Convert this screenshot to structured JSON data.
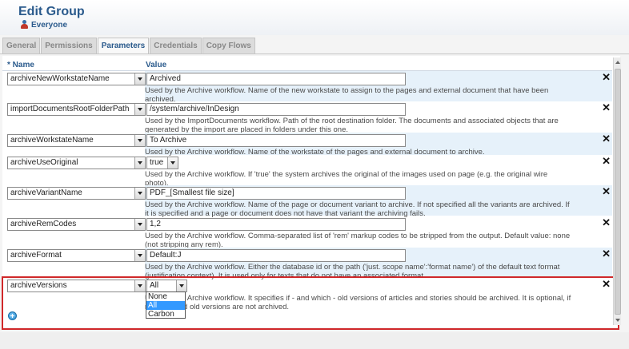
{
  "header": {
    "title": "Edit Group",
    "group_name": "Everyone"
  },
  "tabs": [
    {
      "label": "General"
    },
    {
      "label": "Permissions"
    },
    {
      "label": "Parameters",
      "active": true
    },
    {
      "label": "Credentials"
    },
    {
      "label": "Copy Flows"
    }
  ],
  "columns": {
    "name": "* Name",
    "value": "Value"
  },
  "rows": [
    {
      "name": "archiveNewWorkstateName",
      "value": "Archived",
      "desc": [
        "Used by the Archive workflow. Name of the new workstate to assign to the pages and external document that have been",
        "archived."
      ]
    },
    {
      "name": "importDocumentsRootFolderPath",
      "value": "/system/archive/InDesign",
      "desc": [
        "Used by the ImportDocuments workflow. Path of the root destination folder. The documents and associated objects that are",
        "generated by the import are placed in folders under this one."
      ]
    },
    {
      "name": "archiveWorkstateName",
      "value": "To Archive",
      "desc": [
        "Used by the Archive workflow. Name of the workstate of the pages and external document to archive."
      ]
    },
    {
      "name": "archiveUseOriginal",
      "value": "true",
      "desc": [
        "Used by the Archive workflow. If 'true' the system archives the original of the images used on page (e.g. the original wire",
        "photo)."
      ]
    },
    {
      "name": "archiveVariantName",
      "value": "PDF_[Smallest file size]",
      "desc": [
        "Used by the Archive workflow. Name of the page or document variant to archive. If not specified all the variants are archived. If",
        "it is specified and a page or document does not have that variant the archiving fails."
      ]
    },
    {
      "name": "archiveRemCodes",
      "value": "1,2",
      "desc": [
        "Used by the Archive workflow. Comma-separated list of 'rem' markup codes to be stripped from the output. Default value: none",
        "(not stripping any rem)."
      ]
    },
    {
      "name": "archiveFormat",
      "value": "Default:J",
      "desc": [
        "Used by the Archive workflow. Either the database id or the path ('just. scope name':'format name') of the default text format",
        "(justification context). It is used only for texts that do not have an associated format."
      ]
    },
    {
      "name": "archiveVersions",
      "value": "All",
      "desc": [
        "Used by the Archive workflow. It specifies if - and which - old versions of articles and stories should be archived. It is optional, if",
        "not specified old versions are not archived."
      ]
    }
  ],
  "versions_dropdown": {
    "options": [
      "None",
      "All",
      "Carbon"
    ],
    "selected": "All"
  },
  "colors": {
    "title": "#2a5a8c",
    "desc_bg": "#e6f1fa",
    "highlight": "#d0282a",
    "selected_option": "#3399ff"
  }
}
